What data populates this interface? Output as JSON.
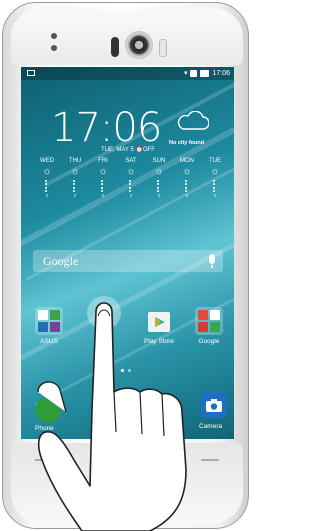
{
  "status_bar": {
    "time": "17:06"
  },
  "clock_widget": {
    "time": "17:06",
    "date": "TUE, MAY 5",
    "alarm": "OFF",
    "city": "No city found"
  },
  "forecast": [
    {
      "day": "WED",
      "temp": "0"
    },
    {
      "day": "THU",
      "temp": "0"
    },
    {
      "day": "FRI",
      "temp": "0"
    },
    {
      "day": "SAT",
      "temp": "0"
    },
    {
      "day": "SUN",
      "temp": "0"
    },
    {
      "day": "MON",
      "temp": "0"
    },
    {
      "day": "TUE",
      "temp": "0"
    }
  ],
  "search": {
    "label": "Google"
  },
  "apps": [
    {
      "name": "ASUS"
    },
    {
      "name": "Play Store"
    },
    {
      "name": "Google"
    }
  ],
  "dock": {
    "left_label": "Phone",
    "right_label": "Camera"
  },
  "icons": [
    "sun-icon",
    "cloud-icon",
    "mic-icon",
    "wifi-icon",
    "battery-icon",
    "camera-icon",
    "phone-icon"
  ],
  "colors": {
    "screen": "#1d8aa0",
    "accent_camera": "#1e6fc4",
    "accent_phone": "#2e9b3c"
  }
}
